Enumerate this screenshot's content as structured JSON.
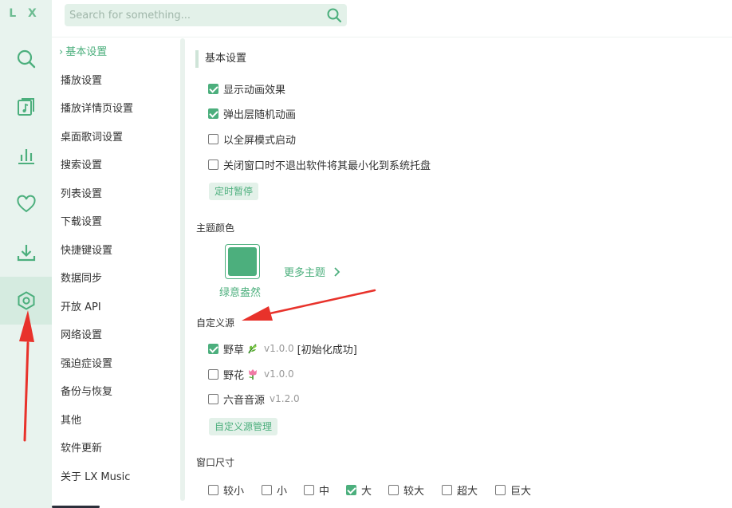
{
  "app": {
    "logo": "L X"
  },
  "rail": {
    "items": [
      {
        "name": "search",
        "icon": "search-icon"
      },
      {
        "name": "song-list",
        "icon": "music-list-icon"
      },
      {
        "name": "leaderboard",
        "icon": "bar-chart-icon"
      },
      {
        "name": "favorites",
        "icon": "heart-icon"
      },
      {
        "name": "download",
        "icon": "download-icon"
      },
      {
        "name": "settings",
        "icon": "settings-hex-icon",
        "active": true
      }
    ]
  },
  "search": {
    "placeholder": "Search for something..."
  },
  "menu": {
    "items": [
      "基本设置",
      "播放设置",
      "播放详情页设置",
      "桌面歌词设置",
      "搜索设置",
      "列表设置",
      "下载设置",
      "快捷键设置",
      "数据同步",
      "开放 API",
      "网络设置",
      "强迫症设置",
      "备份与恢复",
      "其他",
      "软件更新",
      "关于 LX Music"
    ],
    "active_index": 0
  },
  "basic": {
    "title": "基本设置",
    "options": [
      {
        "label": "显示动画效果",
        "checked": true
      },
      {
        "label": "弹出层随机动画",
        "checked": true
      },
      {
        "label": "以全屏模式启动",
        "checked": false
      },
      {
        "label": "关闭窗口时不退出软件将其最小化到系统托盘",
        "checked": false
      }
    ],
    "timer_button": "定时暂停"
  },
  "theme": {
    "label": "主题颜色",
    "current_name": "绿意盎然",
    "current_color": "#4caf7d",
    "more": "更多主题"
  },
  "custom_source": {
    "label": "自定义源",
    "sources": [
      {
        "name": "野草",
        "emoji": "herb",
        "version": "v1.0.0",
        "status": "[初始化成功]",
        "checked": true
      },
      {
        "name": "野花",
        "emoji": "tulip",
        "version": "v1.0.0",
        "status": "",
        "checked": false
      },
      {
        "name": "六音音源",
        "emoji": "",
        "version": "v1.2.0",
        "status": "",
        "checked": false
      }
    ],
    "manage_button": "自定义源管理"
  },
  "window_size": {
    "label": "窗口尺寸",
    "options": [
      {
        "label": "较小",
        "checked": false
      },
      {
        "label": "小",
        "checked": false
      },
      {
        "label": "中",
        "checked": false
      },
      {
        "label": "大",
        "checked": true
      },
      {
        "label": "较大",
        "checked": false
      },
      {
        "label": "超大",
        "checked": false
      },
      {
        "label": "巨大",
        "checked": false
      }
    ]
  },
  "colors": {
    "accent": "#4caf7d",
    "rail_bg": "#e8f3ee",
    "annotation": "#e8322b"
  }
}
